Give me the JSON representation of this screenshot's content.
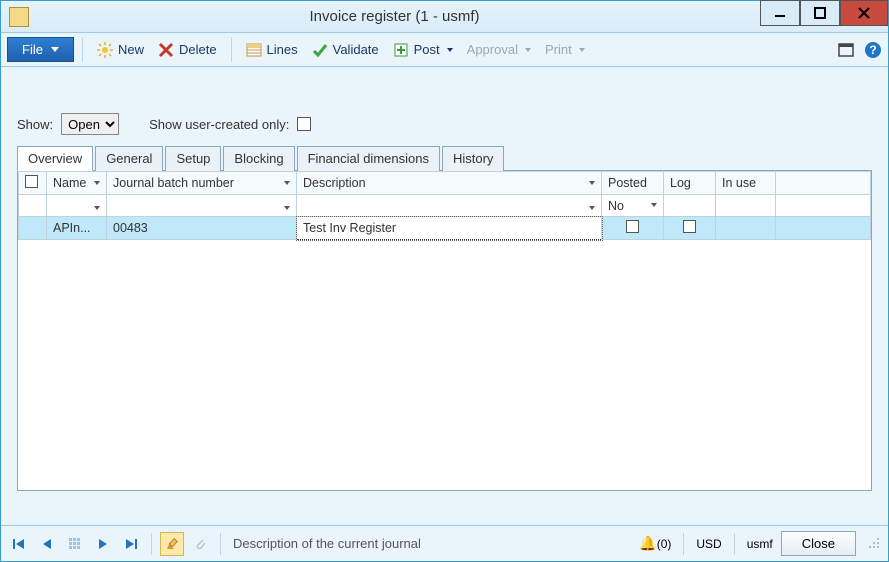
{
  "window": {
    "title": "Invoice register (1 - usmf)"
  },
  "toolbar": {
    "file": "File",
    "new": "New",
    "delete": "Delete",
    "lines": "Lines",
    "validate": "Validate",
    "post": "Post",
    "approval": "Approval",
    "print": "Print"
  },
  "filter": {
    "show_label": "Show:",
    "show_value": "Open",
    "user_created_label": "Show user-created only:"
  },
  "tabs": [
    "Overview",
    "General",
    "Setup",
    "Blocking",
    "Financial dimensions",
    "History"
  ],
  "grid": {
    "columns": {
      "name": "Name",
      "batch": "Journal batch number",
      "desc": "Description",
      "posted": "Posted",
      "log": "Log",
      "inuse": "In use"
    },
    "filter_row": {
      "posted": "No"
    },
    "rows": [
      {
        "name": "APIn...",
        "batch": "00483",
        "desc": "Test Inv Register",
        "posted": false,
        "log": false,
        "inuse": ""
      }
    ]
  },
  "status": {
    "hint": "Description of the current journal",
    "alerts": "(0)",
    "currency": "USD",
    "company": "usmf",
    "close": "Close"
  }
}
